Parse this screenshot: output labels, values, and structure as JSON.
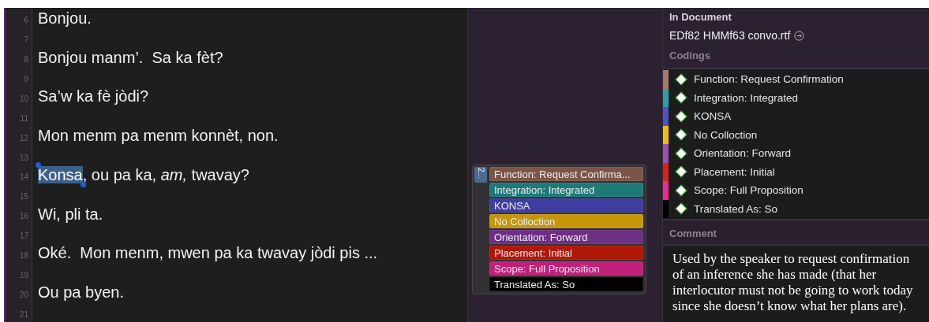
{
  "editor": {
    "lines": [
      {
        "number": "6",
        "segments": [
          {
            "text": "Bonjou.",
            "selected": false
          }
        ]
      },
      {
        "number": "7"
      },
      {
        "number": "8",
        "segments": [
          {
            "text": "Bonjou manm’.  Sa ka fèt?",
            "selected": false
          }
        ]
      },
      {
        "number": "9"
      },
      {
        "number": "10",
        "segments": [
          {
            "text": "Sa’w ka fè jòdi?",
            "selected": false
          }
        ]
      },
      {
        "number": "11"
      },
      {
        "number": "12",
        "segments": [
          {
            "text": "Mon menm pa menm konnèt, non.",
            "selected": false
          }
        ]
      },
      {
        "number": "13"
      },
      {
        "number": "14",
        "segments": [
          {
            "text": "Konsa",
            "selected": true
          },
          {
            "text": ", ou pa ka, *am,* twavay?",
            "selected": false
          }
        ]
      },
      {
        "number": "15"
      },
      {
        "number": "16",
        "segments": [
          {
            "text": "Wi, pli ta.",
            "selected": false
          }
        ]
      },
      {
        "number": "17"
      },
      {
        "number": "18",
        "segments": [
          {
            "text": "Oké.  Mon menm, mwen pa ka twavay jòdi pis ...",
            "selected": false
          }
        ]
      },
      {
        "number": "19"
      },
      {
        "number": "20",
        "segments": [
          {
            "text": "Ou pa byen.",
            "selected": false
          }
        ]
      },
      {
        "number": "21"
      }
    ]
  },
  "popup": {
    "badge": "2...",
    "tags": [
      {
        "label": "Function: Request Confirma...",
        "color": "#7a5548"
      },
      {
        "label": "Integration: Integrated",
        "color": "#1e7a78"
      },
      {
        "label": "KONSA",
        "color": "#3e3ea0"
      },
      {
        "label": "No Colloction",
        "color": "#c4960a"
      },
      {
        "label": "Orientation: Forward",
        "color": "#6e2f86"
      },
      {
        "label": "Placement: Initial",
        "color": "#b01808"
      },
      {
        "label": "Scope: Full Proposition",
        "color": "#c0207a"
      },
      {
        "label": "Translated As: So",
        "color": "#000000"
      }
    ]
  },
  "inspector": {
    "document_heading": "In Document",
    "document": "EDf82 HMMf63 convo.rtf",
    "codings_heading": "Codings",
    "codings": [
      {
        "label": "Function: Request Confirmation",
        "color": "#a87a68"
      },
      {
        "label": "Integration: Integrated",
        "color": "#2aa0a8"
      },
      {
        "label": "KONSA",
        "color": "#5050c8"
      },
      {
        "label": "No Colloction",
        "color": "#f0c000"
      },
      {
        "label": "Orientation: Forward",
        "color": "#9a50b0"
      },
      {
        "label": "Placement: Initial",
        "color": "#e02010"
      },
      {
        "label": "Scope: Full Proposition",
        "color": "#f02890"
      },
      {
        "label": "Translated As: So",
        "color": "#000000"
      }
    ],
    "comment_heading": "Comment",
    "comment": "Used by the speaker to request confirmation of an inference she has made (that her interlocutor must not be going to work today since she doesn’t know what her plans are)."
  }
}
